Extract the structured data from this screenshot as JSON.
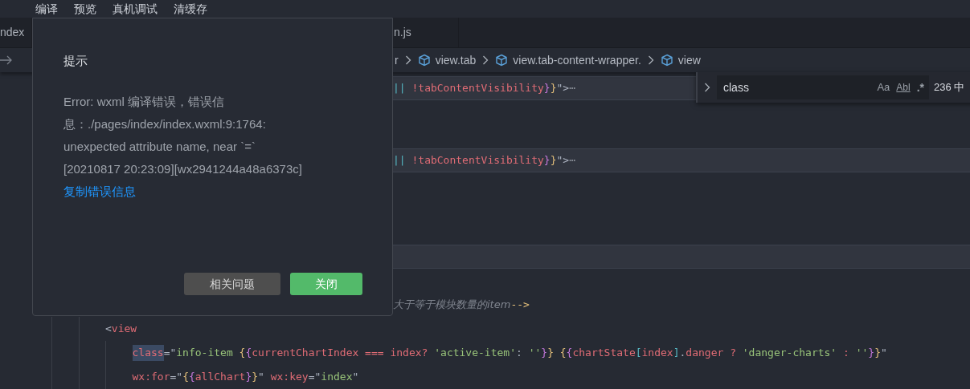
{
  "menu": [
    "编译",
    "预览",
    "真机调试",
    "清缓存"
  ],
  "tabs": [
    {
      "label": "ndex",
      "selected": false
    },
    {
      "label": "n.js",
      "selected": false
    }
  ],
  "breadcrumb": [
    "r",
    "view.tab",
    "view.tab-content-wrapper.",
    "view"
  ],
  "find_widget": {
    "value": "class",
    "options": [
      "Aa",
      "Abl",
      ".*"
    ],
    "result": "236 中"
  },
  "covered_lines": [
    {
      "highlighted": true,
      "segments": [
        {
          "kind": "op",
          "text": "||"
        },
        {
          "kind": "op2",
          "text": " !"
        },
        {
          "kind": "var",
          "text": "tabContentVisibility"
        },
        {
          "kind": "brace2",
          "text": "}"
        },
        {
          "kind": "brace1",
          "text": "}"
        },
        {
          "kind": "punct",
          "text": "\">"
        },
        {
          "kind": "fold",
          "text": "⋯"
        }
      ]
    },
    {
      "highlighted": false
    },
    {
      "highlighted": false
    },
    {
      "highlighted": true,
      "segments": [
        {
          "kind": "op",
          "text": "||"
        },
        {
          "kind": "op2",
          "text": " !"
        },
        {
          "kind": "var",
          "text": "tabContentVisibility"
        },
        {
          "kind": "brace2",
          "text": "}"
        },
        {
          "kind": "brace1",
          "text": "}"
        },
        {
          "kind": "punct",
          "text": "\">"
        },
        {
          "kind": "fold",
          "text": "⋯"
        }
      ]
    },
    {
      "highlighted": false
    },
    {
      "highlighted": false
    },
    {
      "highlighted": false
    },
    {
      "highlighted": true
    },
    {
      "highlighted": false
    },
    {
      "highlighted": false,
      "segments": [
        {
          "kind": "comment",
          "text": "大于等于模块数量的item"
        },
        {
          "kind": "brace1",
          "text": "-->"
        }
      ]
    }
  ],
  "lines": [
    {
      "highlighted": false,
      "segments": [
        {
          "kind": "punct",
          "text": "<"
        },
        {
          "kind": "attr",
          "text": "view"
        }
      ],
      "children": [
        {
          "highlighted": false,
          "segments": [
            {
              "kind": "match",
              "text": "class"
            },
            {
              "kind": "punct",
              "text": "=\""
            },
            {
              "kind": "str",
              "text": "info-item "
            },
            {
              "kind": "brace1",
              "text": "{"
            },
            {
              "kind": "brace2",
              "text": "{"
            },
            {
              "kind": "var",
              "text": "currentChartIndex"
            },
            {
              "kind": "op2",
              "text": " === "
            },
            {
              "kind": "var",
              "text": "index"
            },
            {
              "kind": "op2",
              "text": "? "
            },
            {
              "kind": "str",
              "text": "'active-item'"
            },
            {
              "kind": "punct",
              "text": ": "
            },
            {
              "kind": "str",
              "text": "''"
            },
            {
              "kind": "brace2",
              "text": "}"
            },
            {
              "kind": "brace1",
              "text": "}"
            },
            {
              "kind": "brace1",
              "text": " {"
            },
            {
              "kind": "brace2",
              "text": "{"
            },
            {
              "kind": "var",
              "text": "chartState"
            },
            {
              "kind": "op",
              "text": "["
            },
            {
              "kind": "var",
              "text": "index"
            },
            {
              "kind": "op",
              "text": "]"
            },
            {
              "kind": "punct",
              "text": "."
            },
            {
              "kind": "var",
              "text": "danger"
            },
            {
              "kind": "op2",
              "text": " ? "
            },
            {
              "kind": "str",
              "text": "'danger-charts'"
            },
            {
              "kind": "op2",
              "text": " : "
            },
            {
              "kind": "str",
              "text": "''"
            },
            {
              "kind": "brace2",
              "text": "}"
            },
            {
              "kind": "brace1",
              "text": "}"
            },
            {
              "kind": "punct",
              "text": "\""
            }
          ]
        },
        {
          "highlighted": false,
          "segments": [
            {
              "kind": "attr",
              "text": "wx:for"
            },
            {
              "kind": "punct",
              "text": "=\""
            },
            {
              "kind": "brace1",
              "text": "{"
            },
            {
              "kind": "brace2",
              "text": "{"
            },
            {
              "kind": "var",
              "text": "allChart"
            },
            {
              "kind": "brace2",
              "text": "}"
            },
            {
              "kind": "brace1",
              "text": "}"
            },
            {
              "kind": "punct",
              "text": "\" "
            },
            {
              "kind": "attr",
              "text": "wx:key"
            },
            {
              "kind": "punct",
              "text": "=\""
            },
            {
              "kind": "str",
              "text": "index"
            },
            {
              "kind": "punct",
              "text": "\""
            }
          ]
        }
      ]
    }
  ],
  "dialog": {
    "title": "提示",
    "message": [
      "Error: wxml 编译错误，错误信",
      "息：./pages/index/index.wxml:9:1764:",
      "unexpected attribute name, near `=`",
      "[20210817 20:23:09][wx2941244a48a6373c]"
    ],
    "link": "复制错误信息",
    "buttons": [
      {
        "label": "相关问题",
        "kind": "secondary"
      },
      {
        "label": "关闭",
        "kind": "primary"
      }
    ]
  }
}
